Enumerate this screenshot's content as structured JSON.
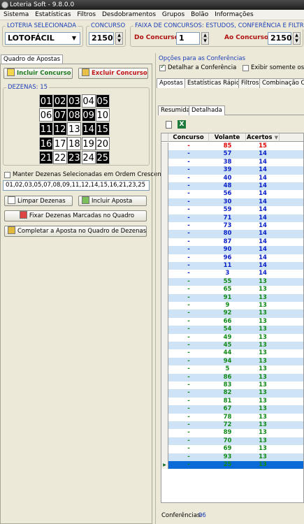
{
  "title": "Loteria Soft - 9.8.0.0",
  "menu": [
    "Sistema",
    "Estatísticas",
    "Filtros",
    "Desdobramentos",
    "Grupos",
    "Bolão",
    "Informações"
  ],
  "loteria": {
    "label": "LOTERIA SELECIONADA",
    "value": "LOTOFÁCIL"
  },
  "concurso": {
    "label": "CONCURSO",
    "value": "2150"
  },
  "faixa": {
    "label": "FAIXA DE CONCURSOS: ESTUDOS, CONFERÊNCIA E FILTROS",
    "do_label": "Do Concurso",
    "do_value": "1",
    "ao_label": "Ao Concurso",
    "ao_value": "2150"
  },
  "left_tab": "Quadro de Apostas",
  "incluir_concurso": "Incluir Concurso",
  "excluir_concurso": "Excluir Concurso",
  "dezenas_label": "DEZENAS: 15",
  "numbers": [
    {
      "n": "01",
      "s": true
    },
    {
      "n": "02",
      "s": true
    },
    {
      "n": "03",
      "s": true
    },
    {
      "n": "04",
      "s": false
    },
    {
      "n": "05",
      "s": true
    },
    {
      "n": "06",
      "s": false
    },
    {
      "n": "07",
      "s": true
    },
    {
      "n": "08",
      "s": true
    },
    {
      "n": "09",
      "s": true
    },
    {
      "n": "10",
      "s": false
    },
    {
      "n": "11",
      "s": true
    },
    {
      "n": "12",
      "s": true
    },
    {
      "n": "13",
      "s": false
    },
    {
      "n": "14",
      "s": true
    },
    {
      "n": "15",
      "s": true
    },
    {
      "n": "16",
      "s": true
    },
    {
      "n": "17",
      "s": false
    },
    {
      "n": "18",
      "s": false
    },
    {
      "n": "19",
      "s": false
    },
    {
      "n": "20",
      "s": false
    },
    {
      "n": "21",
      "s": true
    },
    {
      "n": "22",
      "s": false
    },
    {
      "n": "23",
      "s": true
    },
    {
      "n": "24",
      "s": false
    },
    {
      "n": "25",
      "s": true
    }
  ],
  "manter_label": "Manter Dezenas Selecionadas em Ordem Crescente",
  "dezenas_text": "01,02,03,05,07,08,09,11,12,14,15,16,21,23,25",
  "limpar": "Limpar Dezenas",
  "incluir_aposta": "Incluir Aposta",
  "fixar": "Fixar Dezenas Marcadas no Quadro",
  "completar": "Completar a Aposta no Quadro de Dezenas",
  "opcoes_label": "Opções para as Conferências",
  "detalhar_label": "Detalhar a Conferência",
  "exibir_label": "Exibir somente os Pre",
  "right_tabs": [
    "Apostas",
    "Estatísticas Rápidas",
    "Filtros",
    "Combinação Car"
  ],
  "sub_tabs": [
    "Resumida",
    "Detalhada"
  ],
  "columns": [
    "Concurso",
    "Volante",
    "Acertos"
  ],
  "colors": {
    "red": "#e00000",
    "blue": "#0a22c8",
    "green": "#118a18",
    "selected": "#0a6ad8"
  },
  "rows": [
    {
      "c": "-",
      "v": "85",
      "a": "15",
      "t": "red"
    },
    {
      "c": "-",
      "v": "57",
      "a": "14",
      "t": "blue"
    },
    {
      "c": "-",
      "v": "38",
      "a": "14",
      "t": "blue"
    },
    {
      "c": "-",
      "v": "39",
      "a": "14",
      "t": "blue"
    },
    {
      "c": "-",
      "v": "40",
      "a": "14",
      "t": "blue"
    },
    {
      "c": "-",
      "v": "48",
      "a": "14",
      "t": "blue"
    },
    {
      "c": "-",
      "v": "56",
      "a": "14",
      "t": "blue"
    },
    {
      "c": "-",
      "v": "30",
      "a": "14",
      "t": "blue"
    },
    {
      "c": "-",
      "v": "59",
      "a": "14",
      "t": "blue"
    },
    {
      "c": "-",
      "v": "71",
      "a": "14",
      "t": "blue"
    },
    {
      "c": "-",
      "v": "73",
      "a": "14",
      "t": "blue"
    },
    {
      "c": "-",
      "v": "80",
      "a": "14",
      "t": "blue"
    },
    {
      "c": "-",
      "v": "87",
      "a": "14",
      "t": "blue"
    },
    {
      "c": "-",
      "v": "90",
      "a": "14",
      "t": "blue"
    },
    {
      "c": "-",
      "v": "96",
      "a": "14",
      "t": "blue"
    },
    {
      "c": "-",
      "v": "11",
      "a": "14",
      "t": "blue"
    },
    {
      "c": "-",
      "v": "3",
      "a": "14",
      "t": "blue"
    },
    {
      "c": "-",
      "v": "55",
      "a": "13",
      "t": "green"
    },
    {
      "c": "-",
      "v": "65",
      "a": "13",
      "t": "green"
    },
    {
      "c": "-",
      "v": "91",
      "a": "13",
      "t": "green"
    },
    {
      "c": "-",
      "v": "9",
      "a": "13",
      "t": "green"
    },
    {
      "c": "-",
      "v": "92",
      "a": "13",
      "t": "green"
    },
    {
      "c": "-",
      "v": "66",
      "a": "13",
      "t": "green"
    },
    {
      "c": "-",
      "v": "54",
      "a": "13",
      "t": "green"
    },
    {
      "c": "-",
      "v": "49",
      "a": "13",
      "t": "green"
    },
    {
      "c": "-",
      "v": "45",
      "a": "13",
      "t": "green"
    },
    {
      "c": "-",
      "v": "44",
      "a": "13",
      "t": "green"
    },
    {
      "c": "-",
      "v": "94",
      "a": "13",
      "t": "green"
    },
    {
      "c": "-",
      "v": "5",
      "a": "13",
      "t": "green"
    },
    {
      "c": "-",
      "v": "86",
      "a": "13",
      "t": "green"
    },
    {
      "c": "-",
      "v": "83",
      "a": "13",
      "t": "green"
    },
    {
      "c": "-",
      "v": "82",
      "a": "13",
      "t": "green"
    },
    {
      "c": "-",
      "v": "81",
      "a": "13",
      "t": "green"
    },
    {
      "c": "-",
      "v": "67",
      "a": "13",
      "t": "green"
    },
    {
      "c": "-",
      "v": "78",
      "a": "13",
      "t": "green"
    },
    {
      "c": "-",
      "v": "72",
      "a": "13",
      "t": "green"
    },
    {
      "c": "-",
      "v": "89",
      "a": "13",
      "t": "green"
    },
    {
      "c": "-",
      "v": "70",
      "a": "13",
      "t": "green"
    },
    {
      "c": "-",
      "v": "69",
      "a": "13",
      "t": "green"
    },
    {
      "c": "-",
      "v": "93",
      "a": "13",
      "t": "green"
    },
    {
      "c": "-",
      "v": "25",
      "a": "13",
      "t": "green"
    }
  ],
  "footer_label": "Conferências:",
  "footer_value": "96"
}
